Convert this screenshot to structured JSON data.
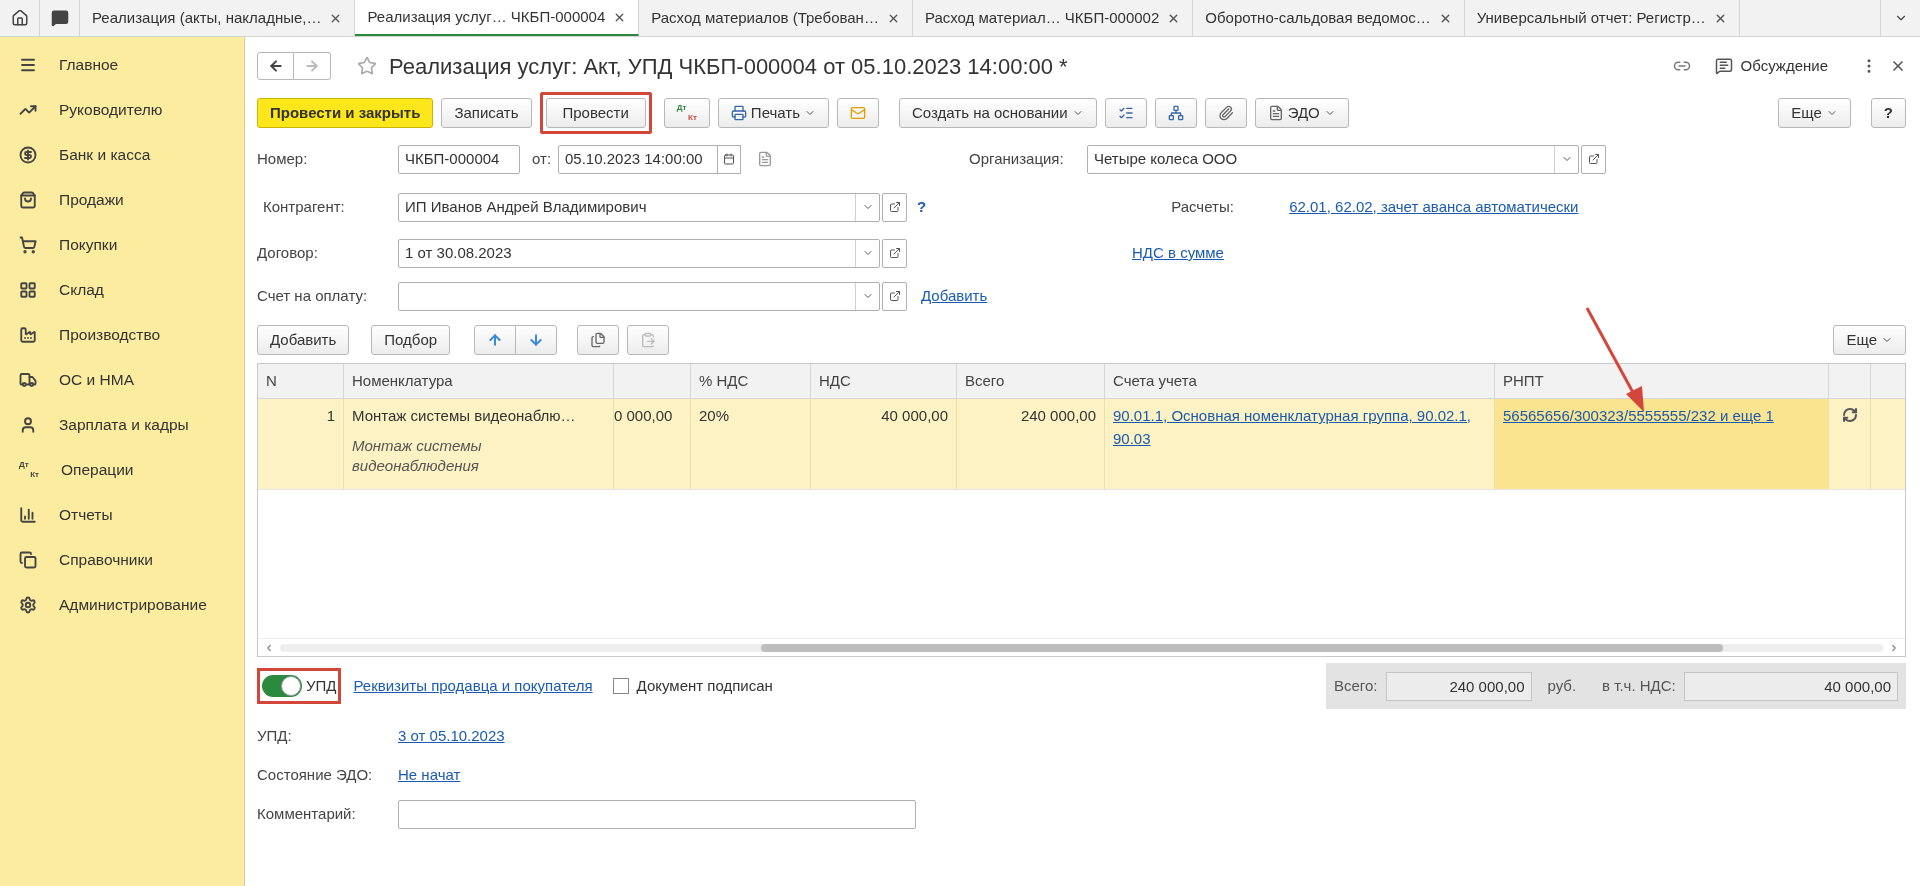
{
  "tabs": [
    {
      "label": "Реализация (акты, накладные,…",
      "selected": false
    },
    {
      "label": "Реализация услуг… ЧКБП-000004",
      "selected": true
    },
    {
      "label": "Расход материалов (Требован…",
      "selected": false
    },
    {
      "label": "Расход материал… ЧКБП-000002",
      "selected": false
    },
    {
      "label": "Оборотно-сальдовая ведомос…",
      "selected": false
    },
    {
      "label": "Универсальный отчет: Регистр…",
      "selected": false
    }
  ],
  "sidebar": {
    "items": [
      {
        "label": "Главное"
      },
      {
        "label": "Руководителю"
      },
      {
        "label": "Банк и касса"
      },
      {
        "label": "Продажи"
      },
      {
        "label": "Покупки"
      },
      {
        "label": "Склад"
      },
      {
        "label": "Производство"
      },
      {
        "label": "ОС и НМА"
      },
      {
        "label": "Зарплата и кадры"
      },
      {
        "label": "Операции",
        "icon_text": {
          "top": "Дт",
          "bottom": "Кт"
        }
      },
      {
        "label": "Отчеты"
      },
      {
        "label": "Справочники"
      },
      {
        "label": "Администрирование"
      }
    ]
  },
  "document": {
    "title": "Реализация услуг: Акт, УПД ЧКБП-000004 от 05.10.2023 14:00:00 *",
    "discussion": "Обсуждение"
  },
  "toolbar": {
    "post_and_close": "Провести и закрыть",
    "save": "Записать",
    "post": "Провести",
    "dt_kt": {
      "top": "Дт",
      "bottom": "Кт"
    },
    "print": "Печать",
    "create_based_on": "Создать на основании",
    "edo": "ЭДО",
    "more": "Еще",
    "help": "?"
  },
  "fields": {
    "number": {
      "label": "Номер:",
      "value": "ЧКБП-000004"
    },
    "date": {
      "label": "от:",
      "value": "05.10.2023 14:00:00"
    },
    "organization": {
      "label": "Организация:",
      "value": "Четыре колеса ООО"
    },
    "counterparty": {
      "label": "Контрагент:",
      "value": "ИП Иванов Андрей Владимирович",
      "help": "?"
    },
    "settlements": {
      "label": "Расчеты:",
      "link": "62.01, 62.02, зачет аванса автоматически"
    },
    "contract": {
      "label": "Договор:",
      "value": "1 от 30.08.2023"
    },
    "vat_link": "НДС в сумме",
    "invoice": {
      "label": "Счет на оплату:",
      "add_link": "Добавить"
    }
  },
  "table_toolbar": {
    "add": "Добавить",
    "select": "Подбор",
    "more": "Еще"
  },
  "table": {
    "columns": [
      "N",
      "Номенклатура",
      "",
      "% НДС",
      "НДС",
      "Всего",
      "Счета учета",
      "РНПТ"
    ],
    "rows": [
      {
        "selected": true,
        "n": "1",
        "item": "Монтаж системы видеонаблю…",
        "item_note": "Монтаж системы видеонаблюдения",
        "column_3": "0 000,00",
        "vat_rate": "20%",
        "vat": "40 000,00",
        "total": "240 000,00",
        "accounts": "90.01.1, Основная номенклатурная группа, 90.02.1, 90.03",
        "rnpt": "56565656/300323/5555555/232 и еще 1"
      }
    ]
  },
  "footer": {
    "upd_toggle": {
      "label": "УПД",
      "on": true
    },
    "requisites_link": "Реквизиты продавца и покупателя",
    "signed": {
      "label": "Документ подписан",
      "checked": false
    },
    "total": {
      "label": "Всего:",
      "value": "240 000,00",
      "currency": "руб."
    },
    "vat_total": {
      "label": "в т.ч. НДС:",
      "value": "40 000,00"
    },
    "upd": {
      "label": "УПД:",
      "link": "3 от 05.10.2023"
    },
    "edo_state": {
      "label": "Состояние ЭДО:",
      "link": "Не начат"
    },
    "comment": {
      "label": "Комментарий:"
    }
  }
}
